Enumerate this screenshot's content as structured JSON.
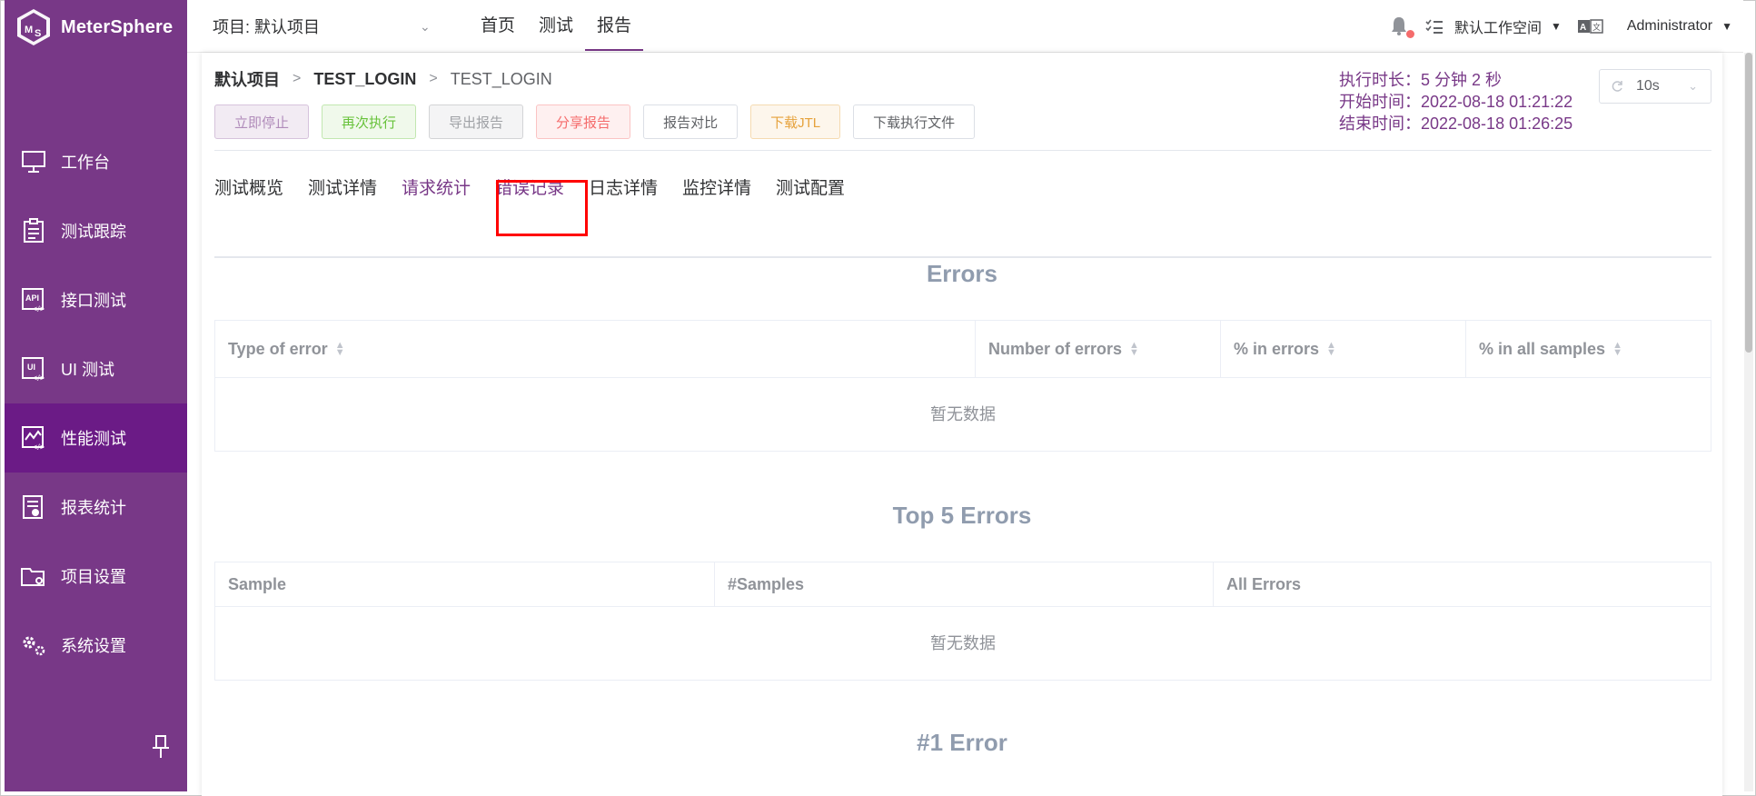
{
  "app": {
    "name": "MeterSphere"
  },
  "sidebar": {
    "items": [
      {
        "label": "工作台",
        "icon": "monitor-icon"
      },
      {
        "label": "测试跟踪",
        "icon": "clipboard-list-icon"
      },
      {
        "label": "接口测试",
        "icon": "api-icon"
      },
      {
        "label": "UI 测试",
        "icon": "ui-test-icon"
      },
      {
        "label": "性能测试",
        "icon": "performance-chart-icon"
      },
      {
        "label": "报表统计",
        "icon": "report-chart-icon"
      },
      {
        "label": "项目设置",
        "icon": "folder-settings-icon"
      },
      {
        "label": "系统设置",
        "icon": "gears-icon"
      }
    ],
    "active_index": 4,
    "pin_icon": "pin-icon"
  },
  "header": {
    "project_label": "项目: 默认项目",
    "menu": [
      "首页",
      "测试",
      "报告"
    ],
    "active_menu": "报告",
    "workspace": "默认工作空间",
    "user": "Administrator"
  },
  "breadcrumb": {
    "project": "默认项目",
    "test": "TEST_LOGIN",
    "report": "TEST_LOGIN"
  },
  "toolbar": {
    "stop": "立即停止",
    "rerun": "再次执行",
    "export": "导出报告",
    "share": "分享报告",
    "compare": "报告对比",
    "download_jtl": "下载JTL",
    "download_exec": "下载执行文件"
  },
  "exec_info": {
    "duration": "执行时长：5 分钟 2 秒",
    "start": "开始时间：2022-08-18 01:21:22",
    "end": "结束时间：2022-08-18 01:26:25"
  },
  "refresh": {
    "value": "10s"
  },
  "tabs": [
    "测试概览",
    "测试详情",
    "请求统计",
    "错误记录",
    "日志详情",
    "监控详情",
    "测试配置"
  ],
  "errors_section": {
    "title": "Errors",
    "columns": [
      "Type of error",
      "Number of errors",
      "% in errors",
      "% in all samples"
    ],
    "empty": "暂无数据"
  },
  "top5_section": {
    "title": "Top 5 Errors",
    "columns": [
      "Sample",
      "#Samples",
      "All Errors"
    ],
    "empty": "暂无数据"
  },
  "error1_section": {
    "title": "#1 Error"
  },
  "colors": {
    "brand": "#783887",
    "active_nav": "#6b1b86",
    "highlight": "#ff0000"
  }
}
